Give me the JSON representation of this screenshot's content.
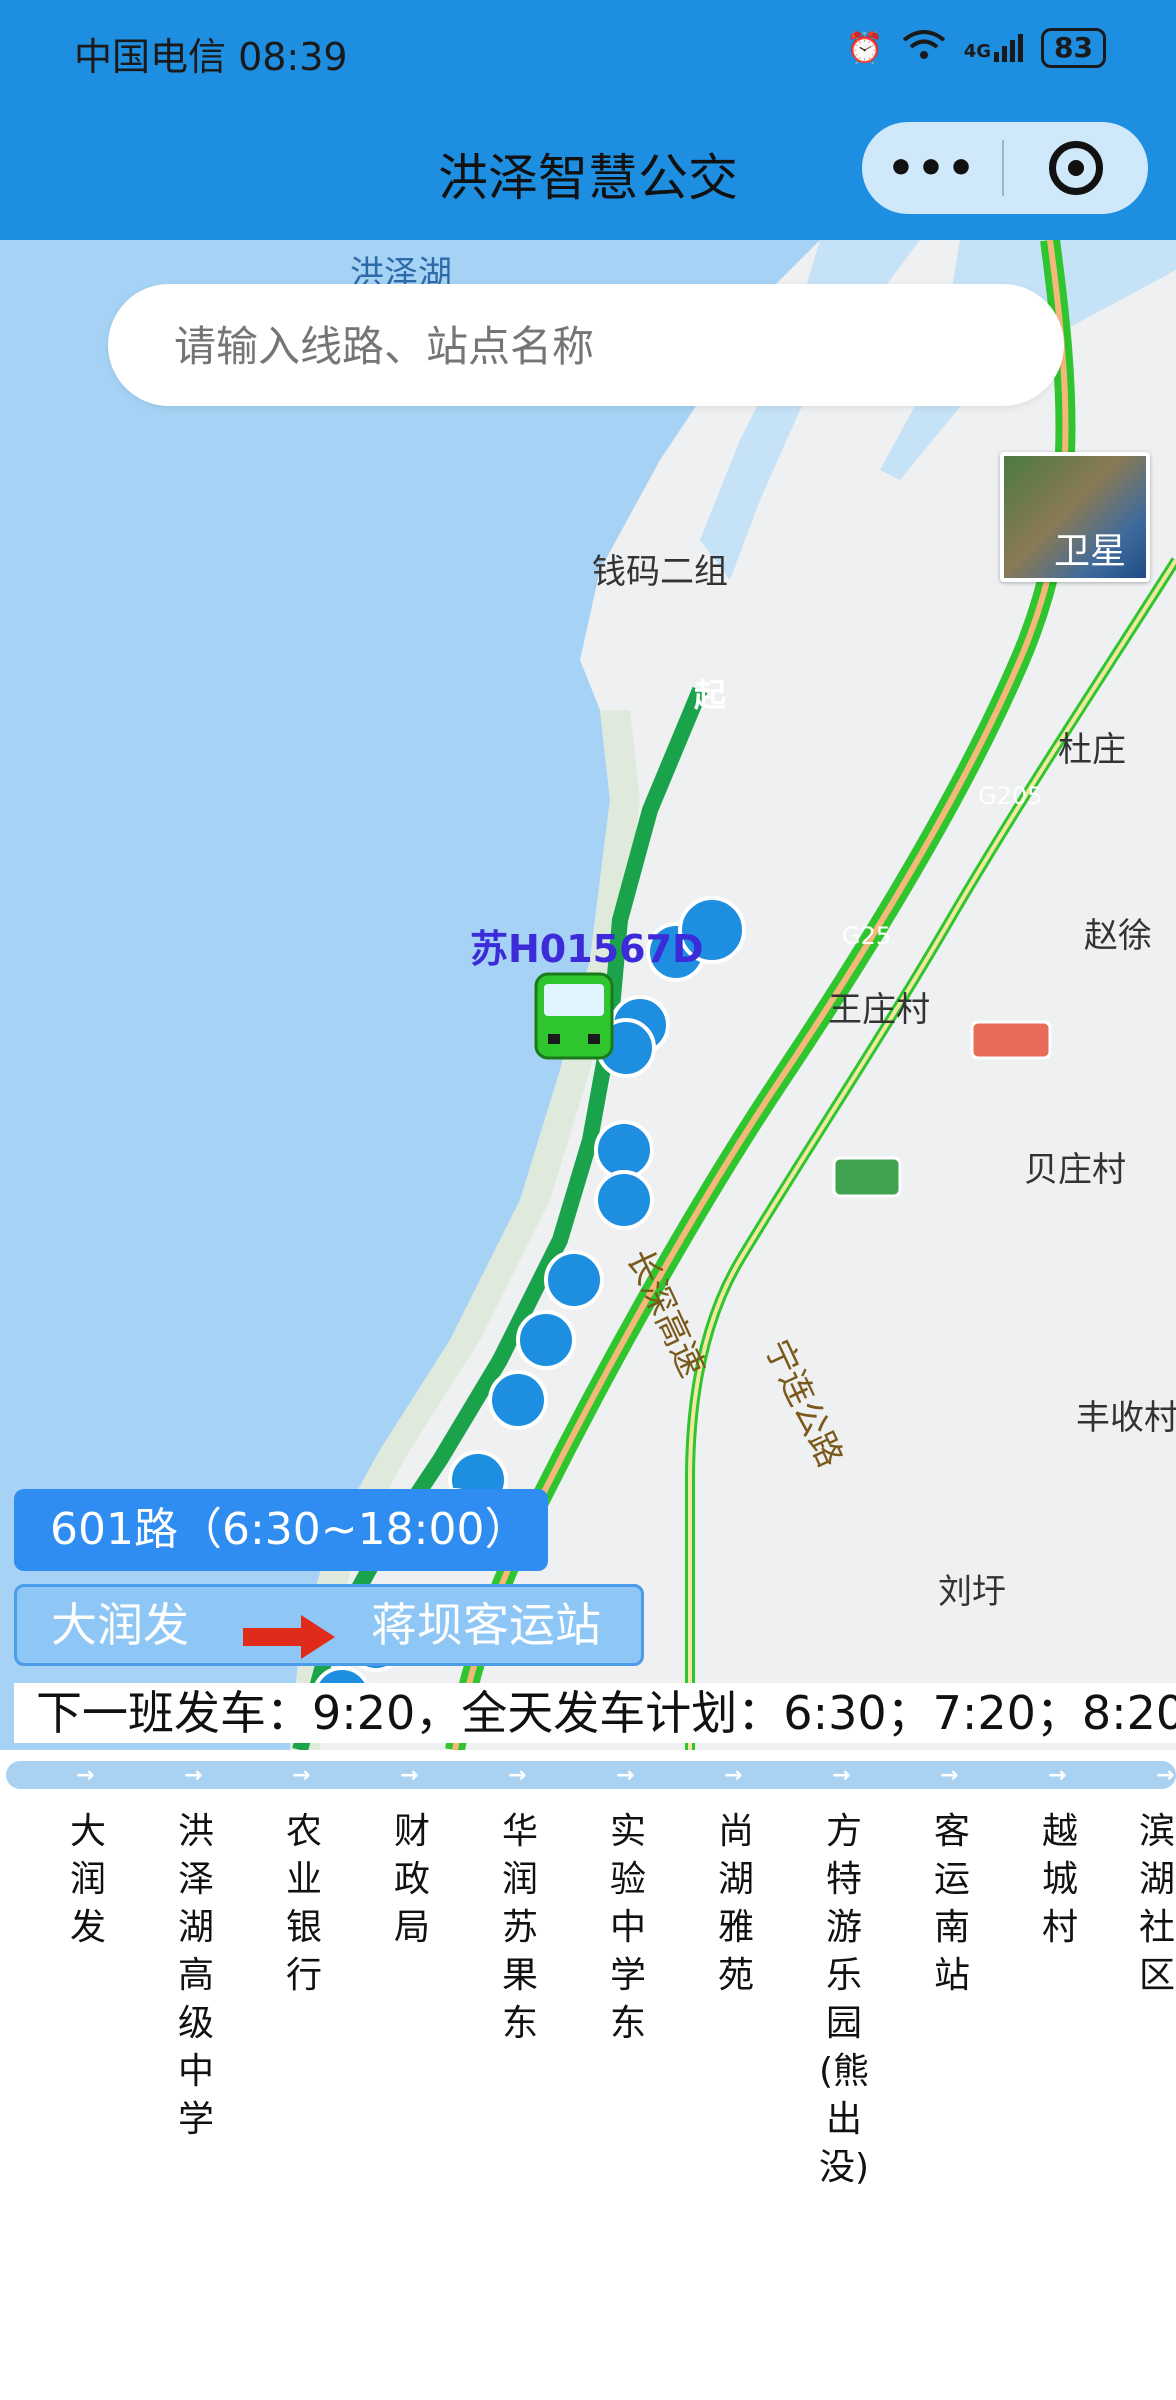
{
  "status_bar": {
    "carrier_time": "中国电信 08:39",
    "network": "4G",
    "battery": "83"
  },
  "app": {
    "title": "洪泽智慧公交"
  },
  "search": {
    "placeholder": "请输入线路、站点名称"
  },
  "map": {
    "satellite_label": "卫星",
    "labels": [
      "洪泽湖",
      "钱码二组",
      "杜庄",
      "G205",
      "赵徐",
      "G25",
      "王庄村",
      "长深高速",
      "贝庄村",
      "宁连公路",
      "丰收村",
      "刘圩"
    ],
    "bus_plate": "苏H01567D",
    "start_marker": "起"
  },
  "route": {
    "title": "601路（6:30~18:00）",
    "from": "大润发",
    "to": "蒋坝客运站",
    "schedule": "下一班发车：9:20，全天发车计划：6:30；7:20；8:20"
  },
  "stops": [
    "大润发",
    "洪泽湖高级中学",
    "农业银行",
    "财政局",
    "华润苏果东",
    "实验中学东",
    "尚湖雅苑",
    "方特游乐园(熊出没)",
    "客运南站",
    "越城村",
    "滨湖社区"
  ],
  "colors": {
    "header": "#1e8ee0",
    "route_title_bg": "#2f8cf0",
    "water": "#a6d3f5",
    "traffic_green": "#2ec52e"
  }
}
